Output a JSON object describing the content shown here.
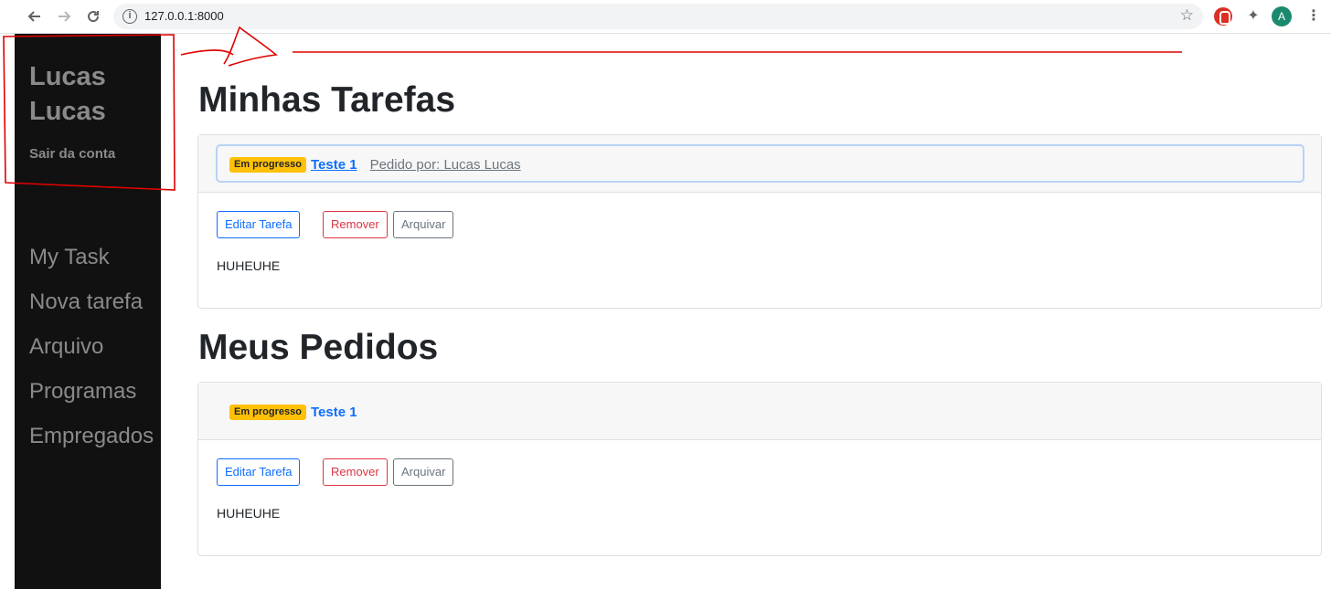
{
  "browser": {
    "url": "127.0.0.1:8000",
    "profile_initial": "A"
  },
  "sidebar": {
    "user_name": "Lucas Lucas",
    "logout": "Sair da conta",
    "menu": [
      {
        "label": "My Task"
      },
      {
        "label": "Nova tarefa"
      },
      {
        "label": "Arquivo"
      },
      {
        "label": "Programas"
      },
      {
        "label": "Empregados"
      }
    ]
  },
  "tasks_section": {
    "title": "Minhas Tarefas",
    "card": {
      "status": "Em progresso",
      "task_title": "Teste 1",
      "requested_by": "Pedido por: Lucas Lucas",
      "edit_label": "Editar Tarefa",
      "remove_label": "Remover",
      "archive_label": "Arquivar",
      "description": "HUHEUHE"
    }
  },
  "requests_section": {
    "title": "Meus Pedidos",
    "card": {
      "status": "Em progresso",
      "task_title": "Teste 1",
      "edit_label": "Editar Tarefa",
      "remove_label": "Remover",
      "archive_label": "Arquivar",
      "description": "HUHEUHE"
    }
  },
  "colors": {
    "sidebar_bg": "#111111",
    "badge_warning": "#ffc107",
    "primary": "#0d6efd",
    "danger": "#dc3545",
    "secondary": "#6c757d",
    "annotation": "#e00000"
  },
  "icons": [
    "back-arrow-icon",
    "forward-arrow-icon",
    "reload-icon",
    "info-icon",
    "star-icon",
    "adblock-icon",
    "puzzle-icon",
    "kebab-menu-icon"
  ]
}
